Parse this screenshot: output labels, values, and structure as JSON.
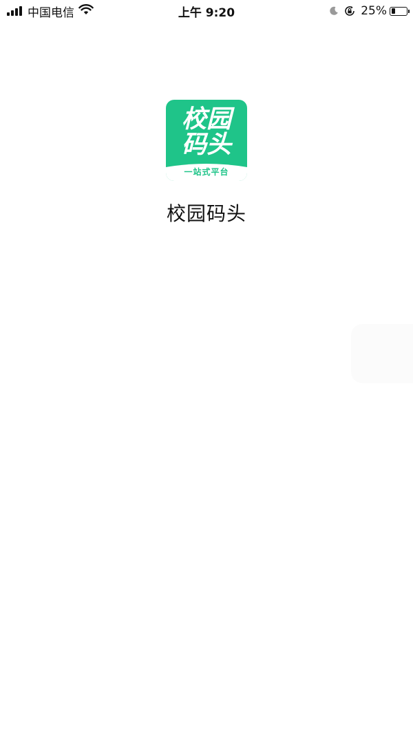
{
  "status_bar": {
    "carrier": "中国电信",
    "time": "上午 9:20",
    "battery_percent": "25%",
    "battery_level": 0.25,
    "icons": [
      "signal-icon",
      "wifi-icon",
      "moon-icon",
      "orientation-lock-icon",
      "battery-icon"
    ]
  },
  "logo": {
    "line1": "校园",
    "line2": "码头",
    "slogan": "一站式平台",
    "color": "#1fc489"
  },
  "app": {
    "name": "校园码头"
  }
}
